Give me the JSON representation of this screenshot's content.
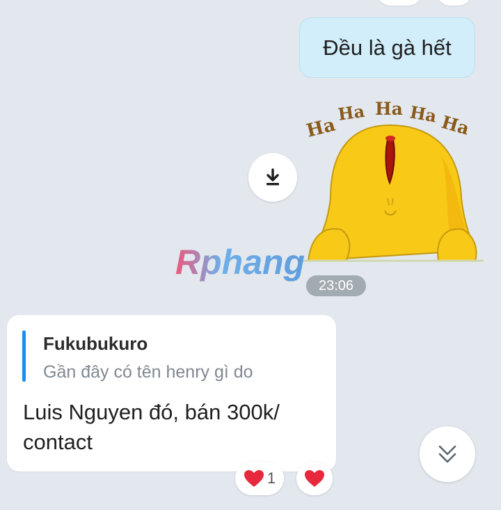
{
  "conversation": {
    "sent_message": {
      "text": "Đều là gà hết"
    },
    "sticker": {
      "caption": "HaHaHaHaHa",
      "icon": "laughing-chick-sticker"
    },
    "download_button": {
      "icon": "download-icon"
    },
    "watermark": {
      "text": "Rphang"
    },
    "time_label": "23:06",
    "received_message": {
      "quote": {
        "author": "Fukubukuro",
        "text": "Gần đây có tên henry gì do"
      },
      "text": "Luis Nguyen đó, bán 300k/ contact"
    },
    "reactions": {
      "heart_count": "1",
      "heart_icon": "heart-icon",
      "add_reaction_icon": "heart-icon"
    },
    "scroll_down_button": {
      "icon": "double-chevron-down-icon"
    }
  },
  "colors": {
    "background": "#e3e8ef",
    "sent_bubble": "#d2eefb",
    "quote_accent": "#1a8ef0",
    "heart": "#e8283c"
  }
}
